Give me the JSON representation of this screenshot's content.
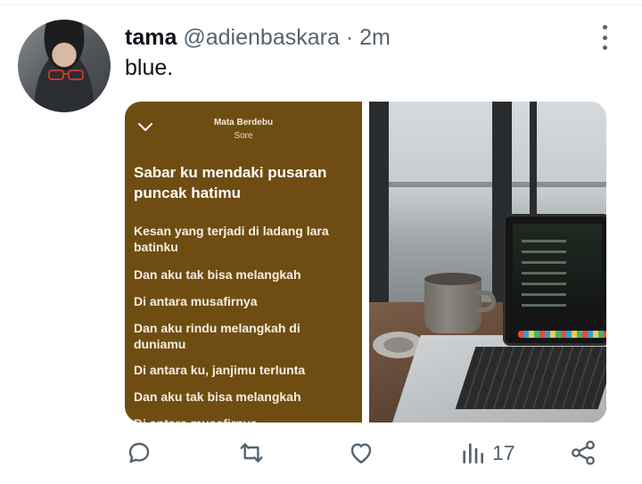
{
  "tweet": {
    "author_name": "tama",
    "handle": "@adienbaskara",
    "separator": " · ",
    "time": "2m",
    "text": "blue."
  },
  "media": {
    "lyrics": {
      "song_title": "Mata Berdebu",
      "artist": "Sore",
      "current_line": "Sabar ku mendaki pusaran puncak hatimu",
      "lines": [
        "Kesan yang terjadi di ladang lara batinku",
        "Dan aku tak bisa melangkah",
        "Di antara musafirnya",
        "Dan aku rindu melangkah di duniamu",
        "Di antara ku, janjimu terlunta",
        "Dan aku tak bisa melangkah",
        "Di antara musafirnya"
      ],
      "background_color": "#6f4d12"
    }
  },
  "actions": {
    "reply_icon": "speech-bubble-icon",
    "retweet_icon": "retweet-icon",
    "like_icon": "heart-icon",
    "views_icon": "bar-chart-icon",
    "views_count": "17",
    "share_icon": "share-icon"
  },
  "colors": {
    "text_primary": "#0f1419",
    "text_secondary": "#536471"
  }
}
